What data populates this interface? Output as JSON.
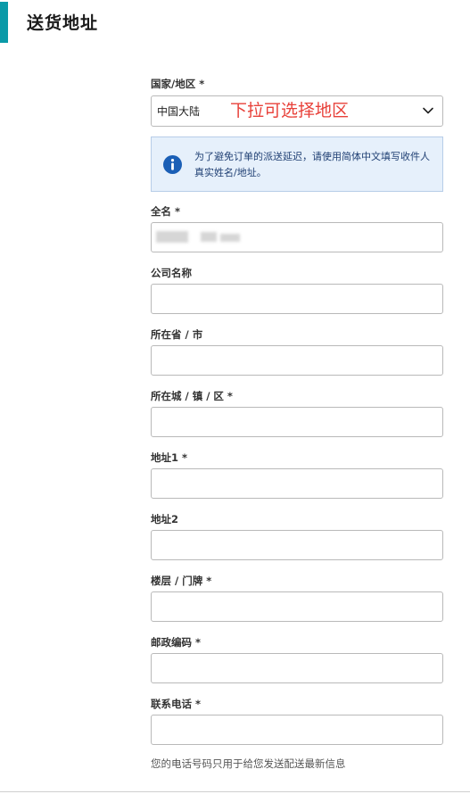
{
  "section": {
    "title": "送货地址"
  },
  "colors": {
    "accent": "#0a9aa8",
    "hint": "#e8413a",
    "info_bg": "#e6f0fb",
    "info_icon": "#1b5fb6"
  },
  "country": {
    "label": "国家/地区 *",
    "value": "中国大陆",
    "hint": "下拉可选择地区",
    "chevron_icon": "chevron-down-icon"
  },
  "notice": {
    "icon": "info-icon",
    "text": "为了避免订单的派送延迟，请使用简体中文填写收件人真实姓名/地址。"
  },
  "fields": {
    "full_name": {
      "label": "全名 *",
      "value_redacted": true
    },
    "company": {
      "label": "公司名称"
    },
    "province": {
      "label": "所在省 / 市"
    },
    "city": {
      "label": "所在城 / 镇 / 区 *"
    },
    "address1": {
      "label": "地址1 *"
    },
    "address2": {
      "label": "地址2"
    },
    "floor": {
      "label": "楼层 / 门牌 *"
    },
    "postal": {
      "label": "邮政编码 *"
    },
    "phone": {
      "label": "联系电话 *",
      "helper": "您的电话号码只用于给您发送配送最新信息"
    }
  }
}
